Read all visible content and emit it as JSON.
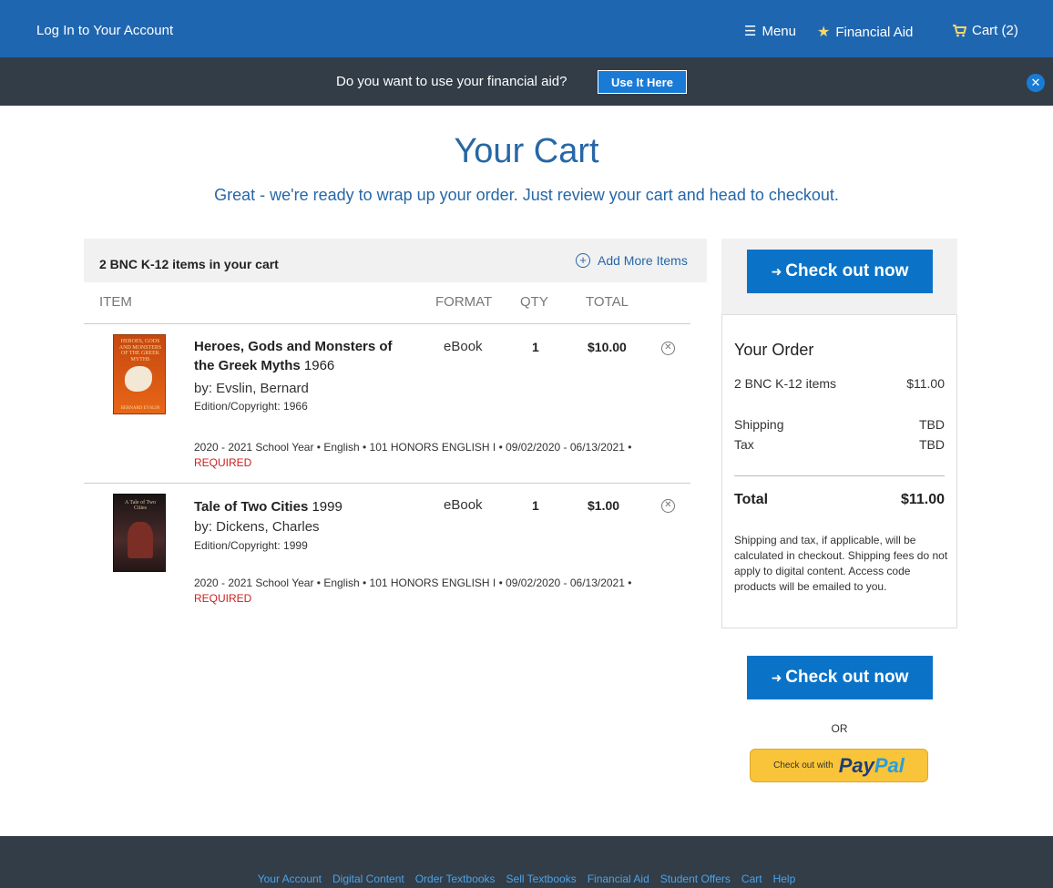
{
  "nav": {
    "login": "Log In to Your Account",
    "menu": "Menu",
    "financial_aid": "Financial Aid",
    "cart": "Cart (2)"
  },
  "aid_banner": {
    "question": "Do you want to use your financial aid?",
    "button": "Use It Here"
  },
  "page": {
    "title": "Your Cart",
    "subtitle": "Great - we're ready to wrap up your order. Just review your cart and head to checkout."
  },
  "cart": {
    "count_label": "2 BNC K-12 items in your cart",
    "add_more": "Add More Items",
    "columns": {
      "item": "ITEM",
      "format": "FORMAT",
      "qty": "QTY",
      "total": "TOTAL"
    },
    "items": [
      {
        "cover_title": "HEROES, GODS AND MONSTERS OF THE GREEK MYTHS",
        "cover_author": "BERNARD EVSLIN",
        "title": "Heroes, Gods and Monsters of the Greek Myths",
        "year": "1966",
        "by": "by: Evslin, Bernard",
        "edition": "Edition/Copyright: 1966",
        "meta": "2020 - 2021 School Year • English • 101 HONORS ENGLISH I • 09/02/2020 - 06/13/2021 •",
        "required": "REQUIRED",
        "format": "eBook",
        "qty": "1",
        "total": "$10.00"
      },
      {
        "cover_title": "A Tale of Two Cities",
        "title": "Tale of Two Cities",
        "year": "1999",
        "by": "by: Dickens, Charles",
        "edition": "Edition/Copyright: 1999",
        "meta": "2020 - 2021 School Year • English • 101 HONORS ENGLISH I • 09/02/2020 - 06/13/2021 •",
        "required": "REQUIRED",
        "format": "eBook",
        "qty": "1",
        "total": "$1.00"
      }
    ]
  },
  "order": {
    "checkout_label": "Check out now",
    "title": "Your Order",
    "items_label": "2 BNC K-12 items",
    "items_value": "$11.00",
    "shipping_label": "Shipping",
    "shipping_value": "TBD",
    "tax_label": "Tax",
    "tax_value": "TBD",
    "total_label": "Total",
    "total_value": "$11.00",
    "note": "Shipping and tax, if applicable, will be calculated in checkout. Shipping fees do not apply to digital content. Access code products will be emailed to you.",
    "or": "OR",
    "paypal_small": "Check out with",
    "paypal_pay": "Pay",
    "paypal_pal": "Pal"
  },
  "footer": {
    "links": [
      "Your Account",
      "Digital Content",
      "Order Textbooks",
      "Sell Textbooks",
      "Financial Aid",
      "Student Offers",
      "Cart",
      "Help"
    ]
  },
  "colors": {
    "nav_blue": "#1f66b0",
    "dark_bar": "#333d47",
    "button_blue": "#0a73c8",
    "title_blue": "#2767a6",
    "required_red": "#cc2222"
  }
}
